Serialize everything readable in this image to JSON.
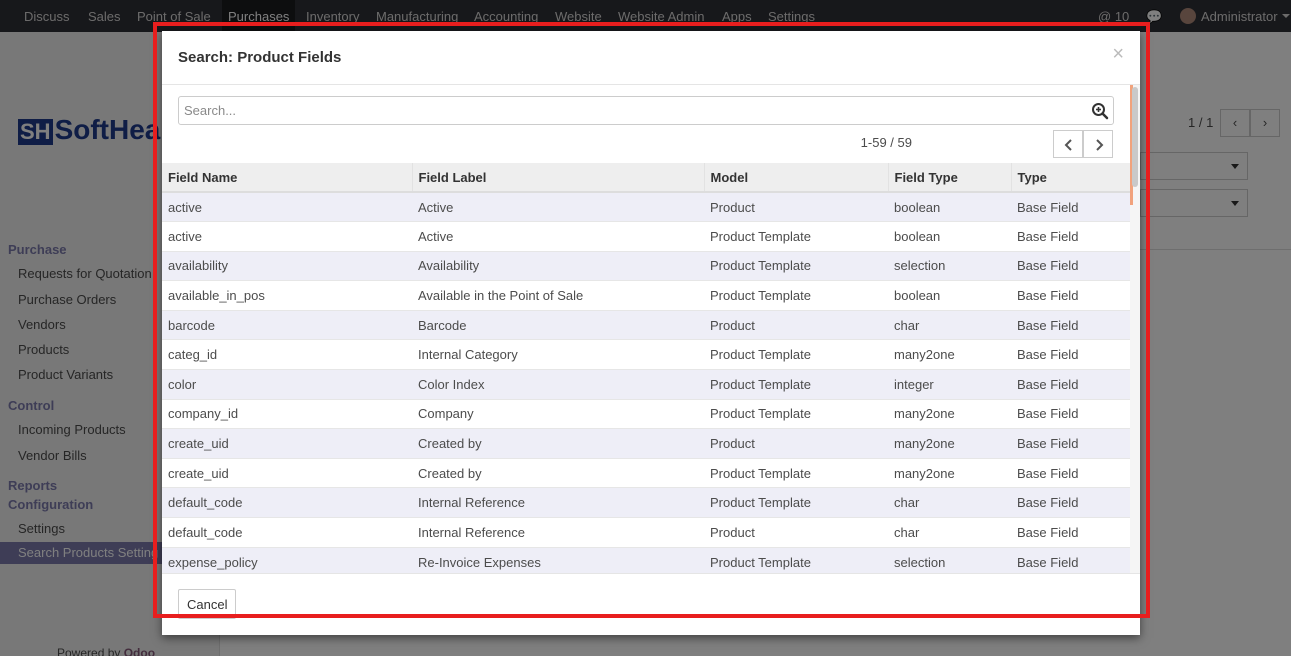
{
  "topbar": {
    "menu": [
      "Discuss",
      "Sales",
      "Point of Sale",
      "Purchases",
      "Inventory",
      "Manufacturing",
      "Accounting",
      "Website",
      "Website Admin",
      "Apps",
      "Settings"
    ],
    "active_menu": "Purchases",
    "messages_count": "10",
    "user": "Administrator"
  },
  "background": {
    "logo_text": "SoftHea",
    "logo_mark": "SH",
    "pager": "1 / 1",
    "sidebar": {
      "purchase_header": "Purchase",
      "requests_for_quotation": "Requests for Quotation",
      "purchase_orders": "Purchase Orders",
      "vendors": "Vendors",
      "products": "Products",
      "product_variants": "Product Variants",
      "control_header": "Control",
      "incoming_products": "Incoming Products",
      "vendor_bills": "Vendor Bills",
      "reports_header": "Reports",
      "configuration_header": "Configuration",
      "settings": "Settings",
      "search_products_settings": "Search Products Setting",
      "powered_by": "Powered by",
      "brand": "Odoo"
    }
  },
  "modal": {
    "title": "Search: Product Fields",
    "search": {
      "placeholder": "Search...",
      "value": ""
    },
    "pager": "1-59 / 59",
    "columns": [
      "Field Name",
      "Field Label",
      "Model",
      "Field Type",
      "Type"
    ],
    "rows": [
      [
        "active",
        "Active",
        "Product",
        "boolean",
        "Base Field"
      ],
      [
        "active",
        "Active",
        "Product Template",
        "boolean",
        "Base Field"
      ],
      [
        "availability",
        "Availability",
        "Product Template",
        "selection",
        "Base Field"
      ],
      [
        "available_in_pos",
        "Available in the Point of Sale",
        "Product Template",
        "boolean",
        "Base Field"
      ],
      [
        "barcode",
        "Barcode",
        "Product",
        "char",
        "Base Field"
      ],
      [
        "categ_id",
        "Internal Category",
        "Product Template",
        "many2one",
        "Base Field"
      ],
      [
        "color",
        "Color Index",
        "Product Template",
        "integer",
        "Base Field"
      ],
      [
        "company_id",
        "Company",
        "Product Template",
        "many2one",
        "Base Field"
      ],
      [
        "create_uid",
        "Created by",
        "Product",
        "many2one",
        "Base Field"
      ],
      [
        "create_uid",
        "Created by",
        "Product Template",
        "many2one",
        "Base Field"
      ],
      [
        "default_code",
        "Internal Reference",
        "Product Template",
        "char",
        "Base Field"
      ],
      [
        "default_code",
        "Internal Reference",
        "Product",
        "char",
        "Base Field"
      ],
      [
        "expense_policy",
        "Re-Invoice Expenses",
        "Product Template",
        "selection",
        "Base Field"
      ]
    ],
    "cancel_label": "Cancel"
  },
  "colors": {
    "highlight_frame": "#e81e1e",
    "odd_row": "#eeeef7",
    "sidebar_accent": "#7c7bad",
    "topbar": "#2f3136"
  }
}
